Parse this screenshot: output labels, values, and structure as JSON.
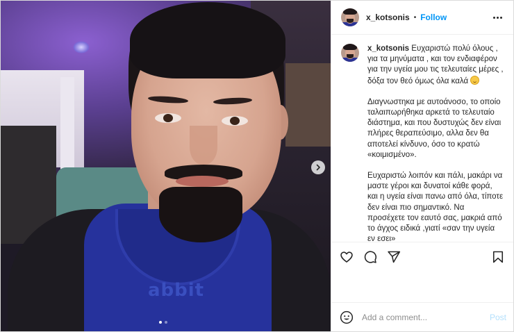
{
  "post": {
    "username": "x_kotsonis",
    "separator": "•",
    "follow_label": "Follow",
    "media_slide_count": 2,
    "media_current_slide": 1,
    "photo_shirt_text": "abbit"
  },
  "caption": {
    "username": "x_kotsonis",
    "paragraph1": "Ευχαριστώ πολύ όλους , για τα μηνύματα , και τον ενδιαφέρον για την υγεία μου τις τελευταίες μέρες , δόξα τον θεό όμως όλα καλά",
    "paragraph2": "Διαγνωστηκα με αυτοάνοσο, το οποίο ταλαιπωρήθηκα αρκετά το τελευταίο διάστημα, και που δυστυχώς δεν είναι πλήρες θεραπεύσιμο, αλλα δεν θα αποτελεί κίνδυνο, όσο το κρατώ «κοιμισμένο».",
    "paragraph3": "Ευχαριστώ λοιπόν και πάλι, μακάρι να μαστε γέροι και δυνατοί κάθε φορά, και η υγεία είναι πανω από όλα, τίποτε δεν είναι πιο σημαντικό. Να προσέχετε τον εαυτό σας, μακριά από το άγχος ειδικά ,γιατί «σαν την υγεία εν εσει»"
  },
  "comment": {
    "placeholder": "Add a comment...",
    "post_label": "Post"
  },
  "icons": {
    "like": "heart-icon",
    "comment": "comment-icon",
    "share": "paper-plane-icon",
    "save": "bookmark-icon",
    "emoji": "smiley-icon",
    "next": "chevron-right-icon",
    "more": "more-horizontal-icon"
  },
  "colors": {
    "accent": "#0095f6",
    "post_disabled": "#b2dffc",
    "text": "#262626",
    "muted": "#8e8e8e",
    "border": "#dbdbdb"
  }
}
